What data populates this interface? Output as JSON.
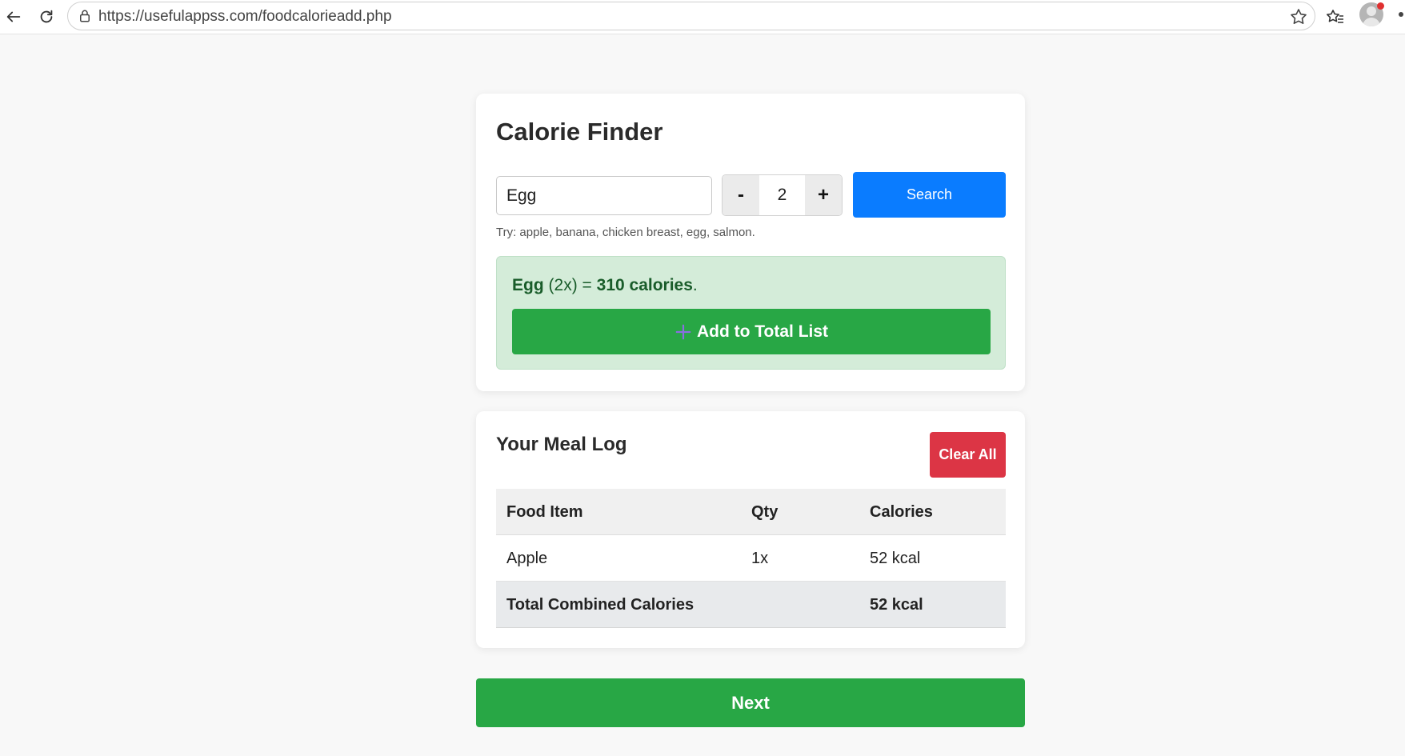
{
  "browser": {
    "url": "https://usefulappss.com/foodcalorieadd.php"
  },
  "finder": {
    "title": "Calorie Finder",
    "food_input_value": "Egg",
    "quantity": "2",
    "minus_label": "-",
    "plus_label": "+",
    "search_label": "Search",
    "hint": "Try: apple, banana, chicken breast, egg, salmon.",
    "result": {
      "food": "Egg",
      "qty_text": "(2x)",
      "equals": "=",
      "calories_text": "310 calories",
      "period": "."
    },
    "add_label": "Add to Total List"
  },
  "meal_log": {
    "title": "Your Meal Log",
    "clear_label": "Clear All",
    "columns": [
      "Food Item",
      "Qty",
      "Calories"
    ],
    "rows": [
      {
        "food": "Apple",
        "qty": "1x",
        "calories": "52 kcal"
      }
    ],
    "total_label": "Total Combined Calories",
    "total_value": "52 kcal"
  },
  "next_label": "Next",
  "colors": {
    "primary_blue": "#0a7cff",
    "success_green": "#28a745",
    "danger_red": "#dc3545",
    "result_bg": "#d4ecd9"
  }
}
